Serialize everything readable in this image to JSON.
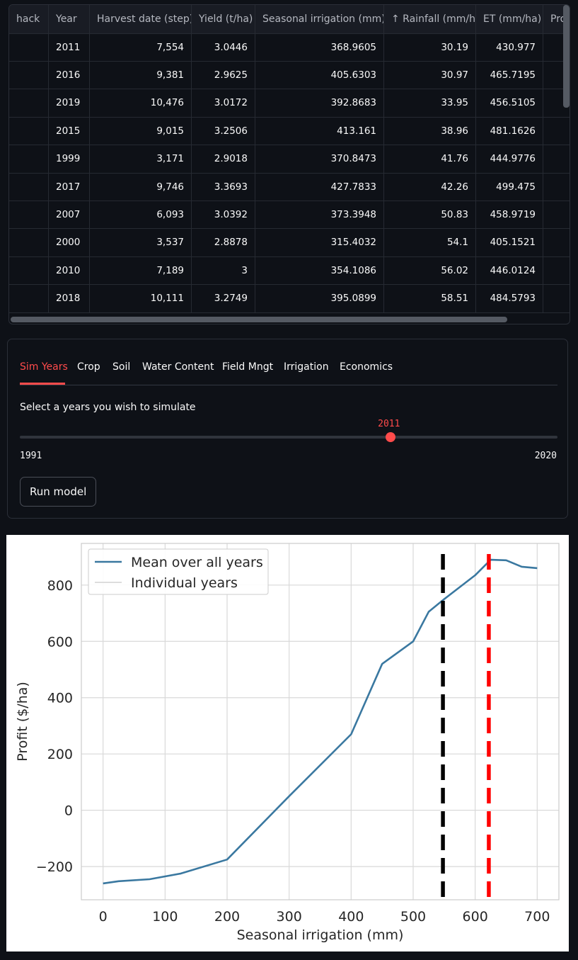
{
  "table": {
    "columns": [
      "hack",
      "Year",
      "Harvest date (step)",
      "Yield (t/ha)",
      "Seasonal irrigation (mm)",
      "↑ Rainfall (mm/ha)",
      "ET (mm/ha)",
      "Pro"
    ],
    "rows": [
      [
        "",
        "2011",
        "7,554",
        "3.0446",
        "368.9605",
        "30.19",
        "430.977",
        ""
      ],
      [
        "",
        "2016",
        "9,381",
        "2.9625",
        "405.6303",
        "30.97",
        "465.7195",
        ""
      ],
      [
        "",
        "2019",
        "10,476",
        "3.0172",
        "392.8683",
        "33.95",
        "456.5105",
        ""
      ],
      [
        "",
        "2015",
        "9,015",
        "3.2506",
        "413.161",
        "38.96",
        "481.1626",
        ""
      ],
      [
        "",
        "1999",
        "3,171",
        "2.9018",
        "370.8473",
        "41.76",
        "444.9776",
        ""
      ],
      [
        "",
        "2017",
        "9,746",
        "3.3693",
        "427.7833",
        "42.26",
        "499.475",
        ""
      ],
      [
        "",
        "2007",
        "6,093",
        "3.0392",
        "373.3948",
        "50.83",
        "458.9719",
        ""
      ],
      [
        "",
        "2000",
        "3,537",
        "2.8878",
        "315.4032",
        "54.1",
        "405.1521",
        ""
      ],
      [
        "",
        "2010",
        "7,189",
        "3",
        "354.1086",
        "56.02",
        "446.0124",
        ""
      ],
      [
        "",
        "2018",
        "10,111",
        "3.2749",
        "395.0899",
        "58.51",
        "484.5793",
        ""
      ]
    ]
  },
  "tabs": [
    "Sim Years",
    "Crop",
    "Soil",
    "Water Content",
    "Field Mngt",
    "Irrigation",
    "Economics"
  ],
  "active_tab": 0,
  "slider": {
    "label": "Select a years you wish to simulate",
    "min": 1991,
    "max": 2020,
    "value": 2011,
    "min_label": "1991",
    "max_label": "2020",
    "value_label": "2011"
  },
  "run_button": "Run model",
  "colors": {
    "accent": "#ff4b4b",
    "background": "#0e1117",
    "line": "#3a78a0",
    "optimal_line": "#ff0000",
    "reference_line": "#000000"
  },
  "chart_data": {
    "type": "line",
    "xlabel": "Seasonal irrigation (mm)",
    "ylabel": "Profit ($/ha)",
    "xlim": [
      -35,
      735
    ],
    "ylim": [
      -318,
      948
    ],
    "xticks": [
      0,
      100,
      200,
      300,
      400,
      500,
      600,
      700
    ],
    "yticks": [
      -200,
      0,
      200,
      400,
      600,
      800
    ],
    "grid": true,
    "legend": {
      "position": "top-left",
      "entries": [
        "Mean over all years",
        "Individual years"
      ]
    },
    "series": [
      {
        "name": "Mean over all years",
        "x": [
          0,
          25,
          75,
          125,
          200,
          300,
          400,
          450,
          500,
          525,
          550,
          600,
          625,
          650,
          675,
          700
        ],
        "y": [
          -260,
          -252,
          -245,
          -225,
          -175,
          50,
          270,
          520,
          600,
          705,
          750,
          835,
          890,
          888,
          865,
          860
        ]
      },
      {
        "name": "Individual years",
        "x": [],
        "y": []
      }
    ],
    "vlines": [
      {
        "x": 548,
        "color": "#000000",
        "style": "dashed"
      },
      {
        "x": 622,
        "color": "#ff0000",
        "style": "dashed"
      }
    ]
  }
}
